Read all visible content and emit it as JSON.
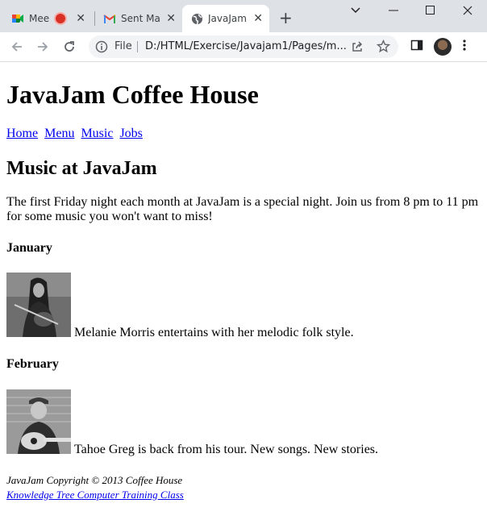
{
  "browser": {
    "tabs": [
      {
        "title": "Mee",
        "icon": "google-meet-icon"
      },
      {
        "title": "Sent Ma",
        "icon": "gmail-icon"
      },
      {
        "title": "JavaJam",
        "icon": "globe-icon"
      }
    ],
    "omnibox": {
      "scheme_label": "File",
      "url": "D:/HTML/Exercise/Javajam1/Pages/m..."
    }
  },
  "page": {
    "title": "JavaJam Coffee House",
    "nav": [
      "Home",
      "Menu",
      "Music",
      "Jobs"
    ],
    "heading": "Music at JavaJam",
    "intro": "The first Friday night each month at JavaJam is a special night. Join us from 8 pm to 11 pm for some music you won't want to miss!",
    "events": [
      {
        "month": "January",
        "description": "Melanie Morris entertains with her melodic folk style."
      },
      {
        "month": "February",
        "description": "Tahoe Greg is back from his tour. New songs. New stories."
      }
    ],
    "footer": {
      "copyright": "JavaJam Copyright © 2013 Coffee House",
      "link": "Knowledge Tree Computer Training Class"
    }
  }
}
